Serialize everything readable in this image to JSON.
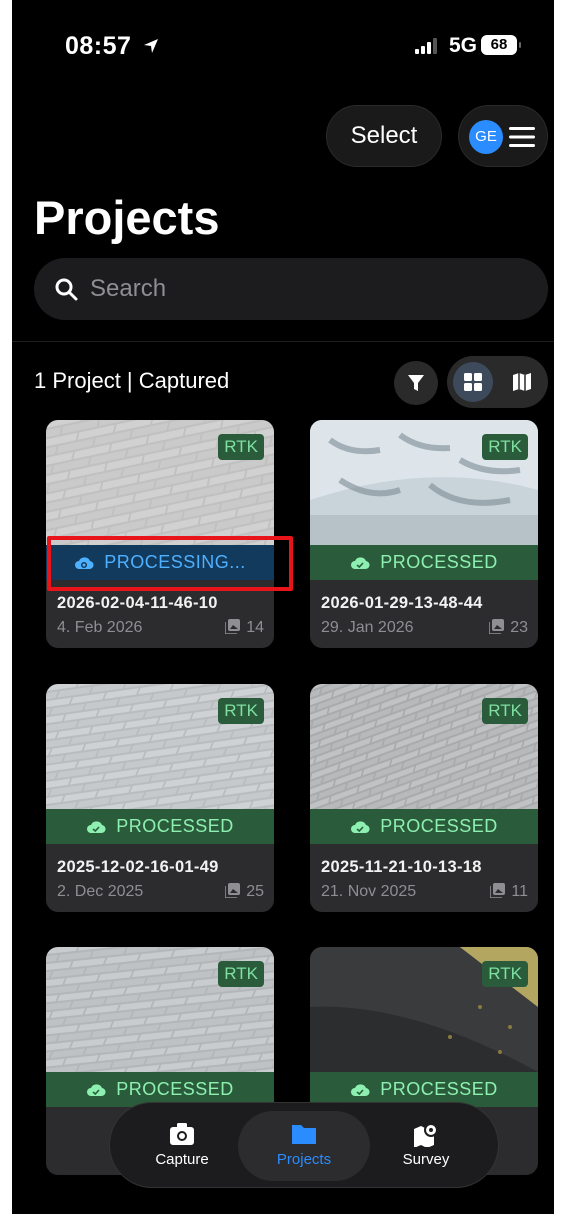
{
  "status_bar": {
    "time": "08:57",
    "network": "5G",
    "battery": "68"
  },
  "header": {
    "select_label": "Select",
    "avatar_initials": "GE",
    "title": "Projects"
  },
  "search": {
    "placeholder": "Search"
  },
  "summary": "1 Project | Captured",
  "cards": [
    {
      "badge": "RTK",
      "status": "PROCESSING...",
      "status_kind": "processing",
      "name": "2026-02-04-11-46-10",
      "date": "4. Feb 2026",
      "count": "14"
    },
    {
      "badge": "RTK",
      "status": "PROCESSED",
      "status_kind": "processed",
      "name": "2026-01-29-13-48-44",
      "date": "29. Jan 2026",
      "count": "23"
    },
    {
      "badge": "RTK",
      "status": "PROCESSED",
      "status_kind": "processed",
      "name": "2025-12-02-16-01-49",
      "date": "2. Dec 2025",
      "count": "25"
    },
    {
      "badge": "RTK",
      "status": "PROCESSED",
      "status_kind": "processed",
      "name": "2025-11-21-10-13-18",
      "date": "21. Nov 2025",
      "count": "11"
    },
    {
      "badge": "RTK",
      "status": "PROCESSED",
      "status_kind": "processed"
    },
    {
      "badge": "RTK",
      "status": "PROCESSED",
      "status_kind": "processed"
    }
  ],
  "tabs": [
    {
      "label": "Capture",
      "icon": "camera-icon"
    },
    {
      "label": "Projects",
      "icon": "folder-icon",
      "active": true
    },
    {
      "label": "Survey",
      "icon": "map-pin-icon"
    }
  ],
  "colors": {
    "accent": "#2a8cff",
    "processed": "#2a5c3c",
    "processing": "#123a5c",
    "highlight": "#e8141a"
  }
}
